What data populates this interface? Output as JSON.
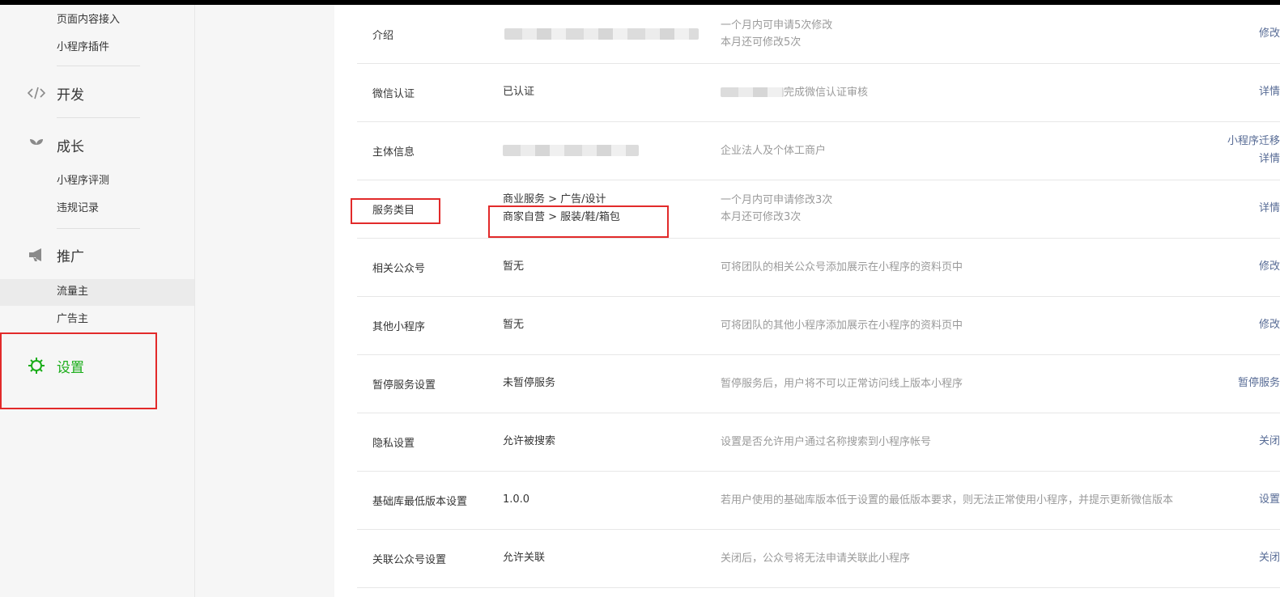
{
  "sidebar": {
    "sub_top": [
      "页面内容接入",
      "小程序插件"
    ],
    "dev": {
      "label": "开发",
      "icon": "code-icon"
    },
    "growth": {
      "label": "成长",
      "icon": "sprout-icon"
    },
    "growth_items": [
      "小程序评测",
      "违规记录"
    ],
    "promo": {
      "label": "推广",
      "icon": "megaphone-icon"
    },
    "promo_items": [
      "流量主",
      "广告主"
    ],
    "settings": {
      "label": "设置",
      "icon": "gear-icon"
    }
  },
  "rows": [
    {
      "label": "介绍",
      "values": [],
      "desc": [
        "一个月内可申请5次修改",
        "本月还可修改5次"
      ],
      "actions": [
        "修改"
      ]
    },
    {
      "label": "微信认证",
      "values": [
        "已认证"
      ],
      "desc": [
        "完成微信认证审核"
      ],
      "actions": [
        "详情"
      ]
    },
    {
      "label": "主体信息",
      "values": [],
      "desc": [
        "企业法人及个体工商户"
      ],
      "actions": [
        "小程序迁移",
        "详情"
      ]
    },
    {
      "label": "服务类目",
      "values": [
        "商业服务 > 广告/设计",
        "商家自营 > 服装/鞋/箱包"
      ],
      "desc": [
        "一个月内可申请修改3次",
        "本月还可修改3次"
      ],
      "actions": [
        "详情"
      ]
    },
    {
      "label": "相关公众号",
      "values": [
        "暂无"
      ],
      "desc": [
        "可将团队的相关公众号添加展示在小程序的资料页中"
      ],
      "actions": [
        "修改"
      ]
    },
    {
      "label": "其他小程序",
      "values": [
        "暂无"
      ],
      "desc": [
        "可将团队的其他小程序添加展示在小程序的资料页中"
      ],
      "actions": [
        "修改"
      ]
    },
    {
      "label": "暂停服务设置",
      "values": [
        "未暂停服务"
      ],
      "desc": [
        "暂停服务后，用户将不可以正常访问线上版本小程序"
      ],
      "actions": [
        "暂停服务"
      ]
    },
    {
      "label": "隐私设置",
      "values": [
        "允许被搜索"
      ],
      "desc": [
        "设置是否允许用户通过名称搜索到小程序帐号"
      ],
      "actions": [
        "关闭"
      ]
    },
    {
      "label": "基础库最低版本设置",
      "values": [
        "1.0.0"
      ],
      "desc": [
        "若用户使用的基础库版本低于设置的最低版本要求，则无法正常使用小程序，并提示更新微信版本"
      ],
      "actions": [
        "设置"
      ]
    },
    {
      "label": "关联公众号设置",
      "values": [
        "允许关联"
      ],
      "desc": [
        "关闭后，公众号将无法申请关联此小程序"
      ],
      "actions": [
        "关闭"
      ]
    }
  ],
  "colors": {
    "accent_green": "#1aad19",
    "link_blue": "#576b95",
    "highlight_red": "#e22a2a"
  }
}
